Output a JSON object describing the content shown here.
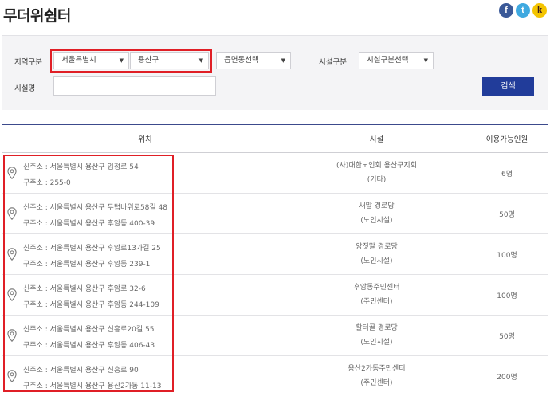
{
  "page": {
    "title": "무더위쉼터"
  },
  "social": {
    "facebook": "f",
    "twitter": "t",
    "kakao": "k"
  },
  "search": {
    "region_label": "지역구분",
    "city_select": "서울특별시",
    "district_select": "용산구",
    "town_select": "읍면동선택",
    "facility_type_label": "시설구분",
    "facility_type_select": "시설구분선택",
    "facility_name_label": "시설명",
    "facility_name_value": "",
    "search_button": "검색"
  },
  "table": {
    "headers": {
      "location": "위치",
      "facility": "시설",
      "capacity": "이용가능인원"
    },
    "rows": [
      {
        "new_addr": "신주소 : 서울특별시 용산구 임정로 54",
        "old_addr": "구주소 : 255-0",
        "name": "(사)대한노인회 용산구지회",
        "type": "(기타)",
        "capacity": "6명"
      },
      {
        "new_addr": "신주소 : 서울특별시 용산구 두텁바위로58길 48",
        "old_addr": "구주소 : 서울특별시 용산구 후암동 400-39",
        "name": "새말 경로당",
        "type": "(노인시설)",
        "capacity": "50명"
      },
      {
        "new_addr": "신주소 : 서울특별시 용산구 후암로13가길 25",
        "old_addr": "구주소 : 서울특별시 용산구 후암동 239-1",
        "name": "양짓말 경로당",
        "type": "(노인시설)",
        "capacity": "100명"
      },
      {
        "new_addr": "신주소 : 서울특별시 용산구 후암로 32-6",
        "old_addr": "구주소 : 서울특별시 용산구 후암동 244-109",
        "name": "후암동주민센터",
        "type": "(주민센터)",
        "capacity": "100명"
      },
      {
        "new_addr": "신주소 : 서울특별시 용산구 신흥로20길 55",
        "old_addr": "구주소 : 서울특별시 용산구 후암동 406-43",
        "name": "활터골 경로당",
        "type": "(노인시설)",
        "capacity": "50명"
      },
      {
        "new_addr": "신주소 : 서울특별시 용산구 신흥로 90",
        "old_addr": "구주소 : 서울특별시 용산구 용산2가동 11-13",
        "name": "용산2가동주민센터",
        "type": "(주민센터)",
        "capacity": "200명"
      }
    ]
  },
  "colors": {
    "accent": "#213c9a",
    "highlight": "#e01f26",
    "header_rule": "#3c4a8c",
    "panel_bg": "#f4f4f6"
  }
}
